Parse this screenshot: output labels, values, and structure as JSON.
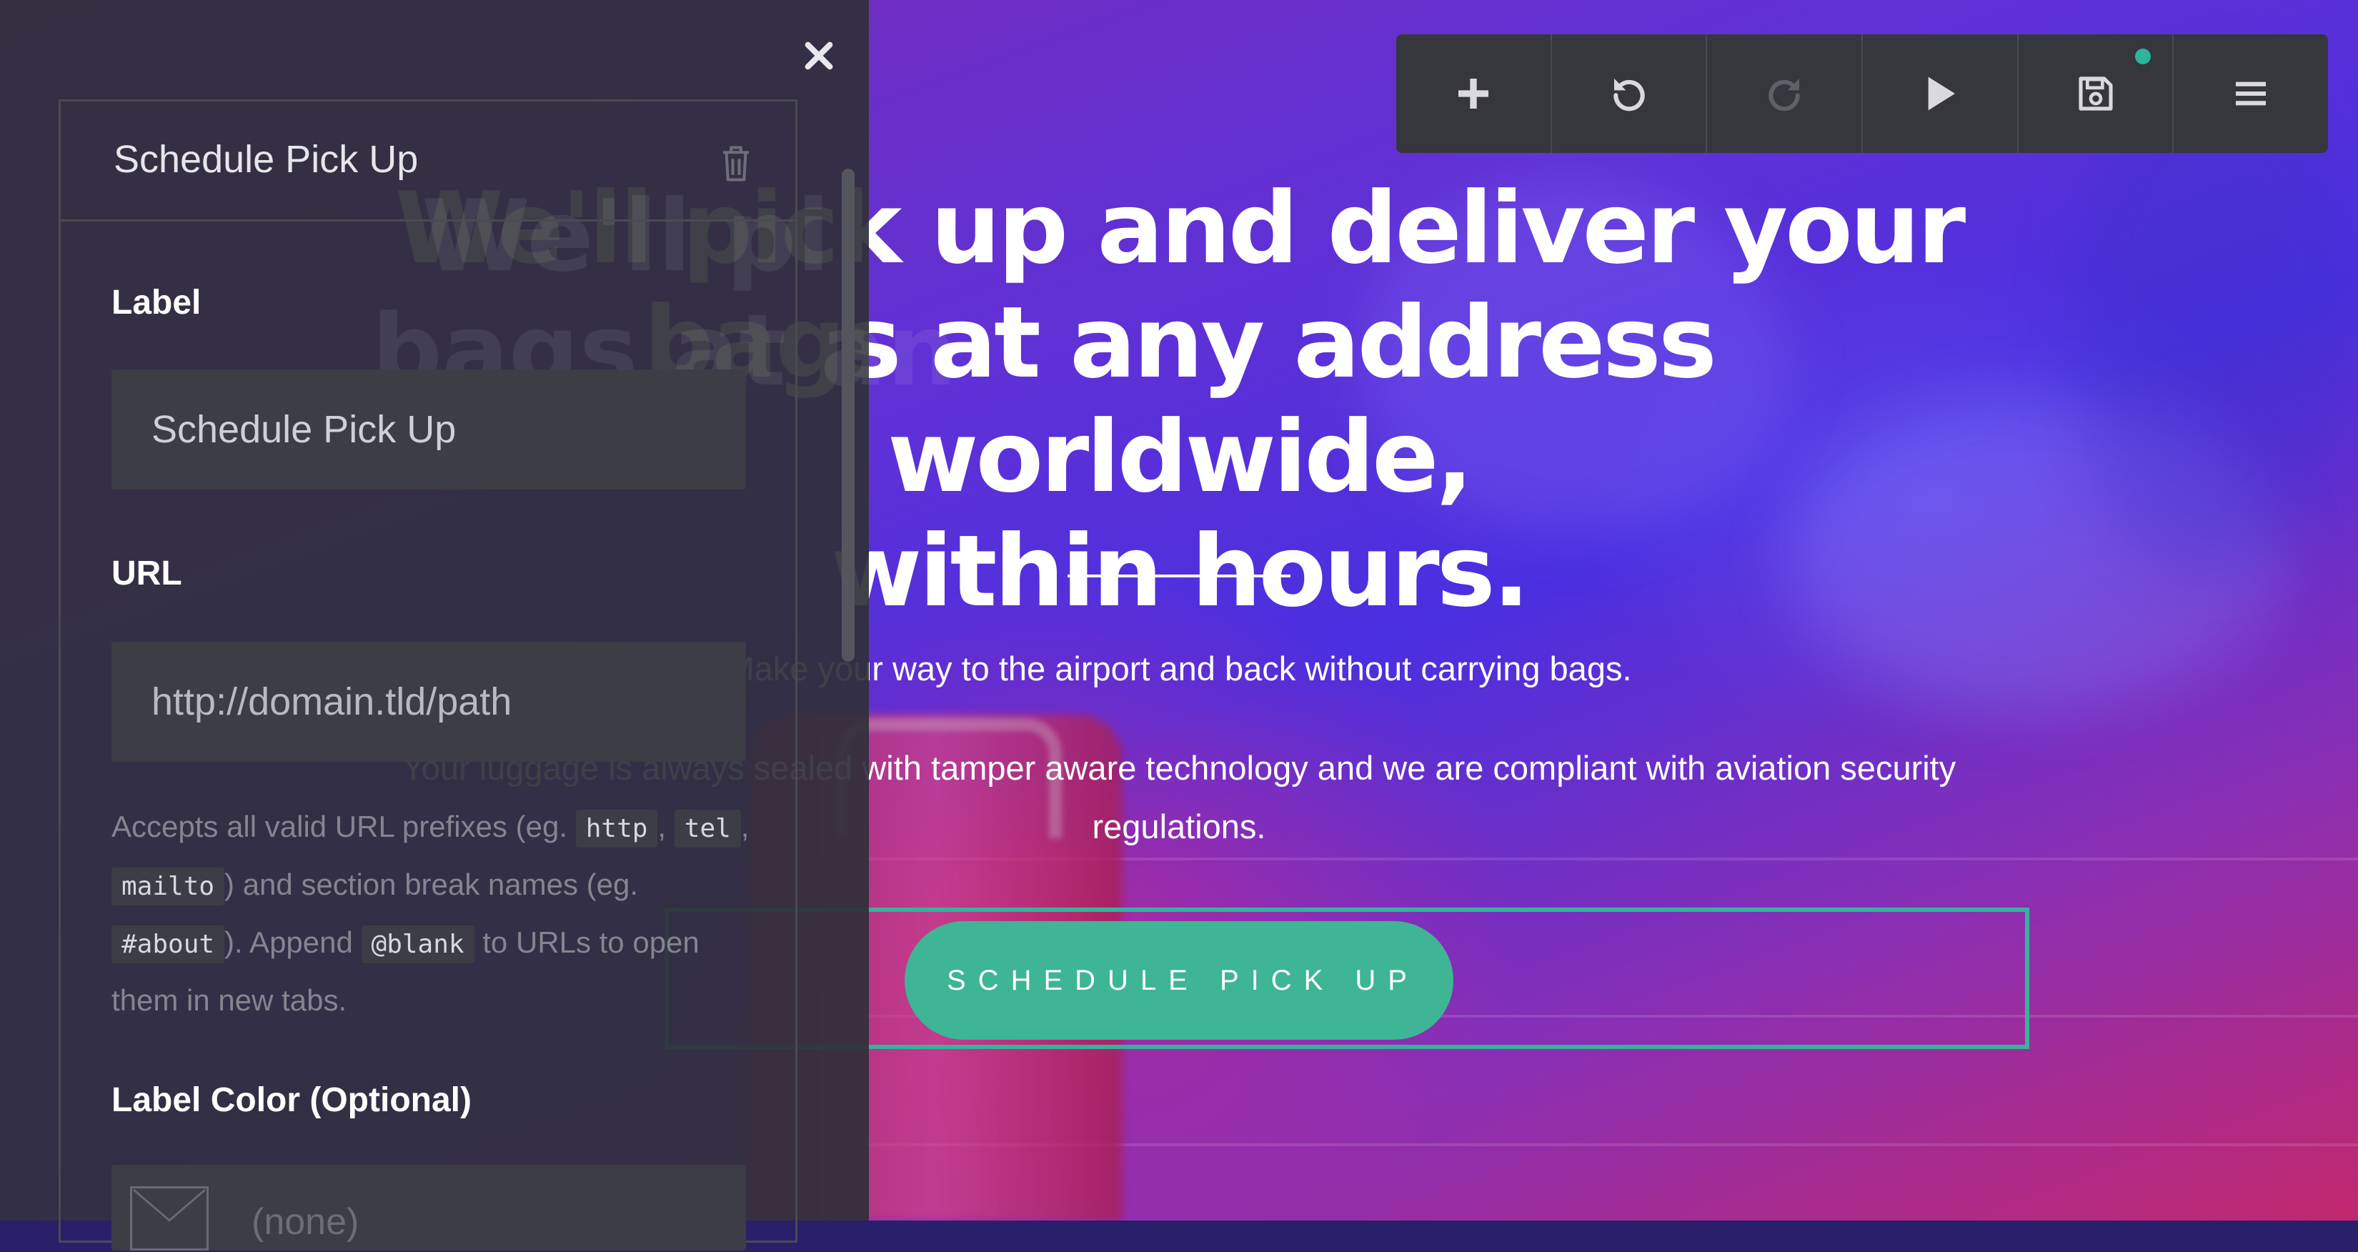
{
  "hero": {
    "title_line1": "We'll pick up and deliver your",
    "title_line2": "bags at any address worldwide,",
    "title_line3": "within hours.",
    "subtitle1": "Make your way to the airport and back without carrying bags.",
    "subtitle2_line1": "Your luggage is always sealed with tamper aware technology and we are compliant with aviation security",
    "subtitle2_line2": "regulations.",
    "cta_label": "Schedule Pick Up"
  },
  "toolbar": {
    "items": [
      {
        "icon": "plus-icon"
      },
      {
        "icon": "undo-icon"
      },
      {
        "icon": "redo-icon"
      },
      {
        "icon": "play-icon"
      },
      {
        "icon": "save-icon"
      },
      {
        "icon": "menu-icon"
      }
    ],
    "unsaved_indicator_color": "#2bb59a"
  },
  "panel": {
    "section_title": "Schedule Pick Up",
    "fields": {
      "label": {
        "label": "Label",
        "value": "Schedule Pick Up"
      },
      "url": {
        "label": "URL",
        "placeholder": "http://domain.tld/path"
      },
      "url_help": {
        "t1": "Accepts all valid URL prefixes (eg. ",
        "c1": "http",
        "t2": ", ",
        "c2": "tel",
        "t3": ", ",
        "c3": "mailto",
        "t4": ") and section break names (eg. ",
        "c4": "#about",
        "t5": "). Append ",
        "c5": "@blank",
        "t6": " to URLs to open them in new tabs."
      },
      "label_color": {
        "label": "Label Color (Optional)",
        "value": "(none)"
      }
    }
  },
  "colors": {
    "accent": "#3eb595",
    "panel_bg": "#303038",
    "toolbar_bg": "#36363d"
  }
}
